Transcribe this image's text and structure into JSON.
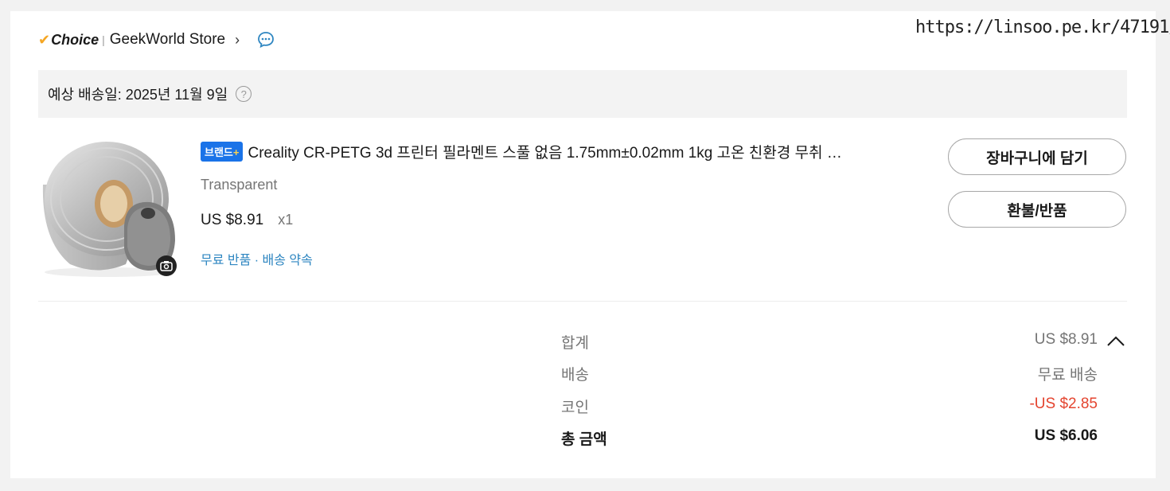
{
  "watermark": "https://linsoo.pe.kr/47191/",
  "store": {
    "choice_label": "Choice",
    "name": "GeekWorld Store",
    "chevron": "›"
  },
  "delivery": {
    "text": "예상 배송일: 2025년 11월 9일",
    "help": "?"
  },
  "product": {
    "badge_label": "브랜드",
    "badge_plus": "+",
    "title": "Creality CR-PETG 3d 프린터 필라멘트 스풀 없음 1.75mm±0.02mm 1kg 고온 친환경 무취 …",
    "variant": "Transparent",
    "price": "US $8.91",
    "quantity": "x1",
    "perks": "무료 반품 · 배송 약속"
  },
  "actions": {
    "cart_label": "장바구니에 담기",
    "refund_label": "환불/반품"
  },
  "summary": {
    "subtotal_label": "합계",
    "subtotal_value": "US $8.91",
    "shipping_label": "배송",
    "shipping_value": "무료 배송",
    "coin_label": "코인",
    "coin_value": "-US $2.85",
    "total_label": "총 금액",
    "total_value": "US $6.06"
  },
  "colors": {
    "accent_blue": "#1a73e8",
    "link_blue": "#2e86c1",
    "discount_red": "#e4442f",
    "choice_check": "#f5a623"
  },
  "icons": [
    "chat-icon",
    "help-icon",
    "camera-icon",
    "chevron-right-icon",
    "chevron-up-icon",
    "check-icon"
  ]
}
